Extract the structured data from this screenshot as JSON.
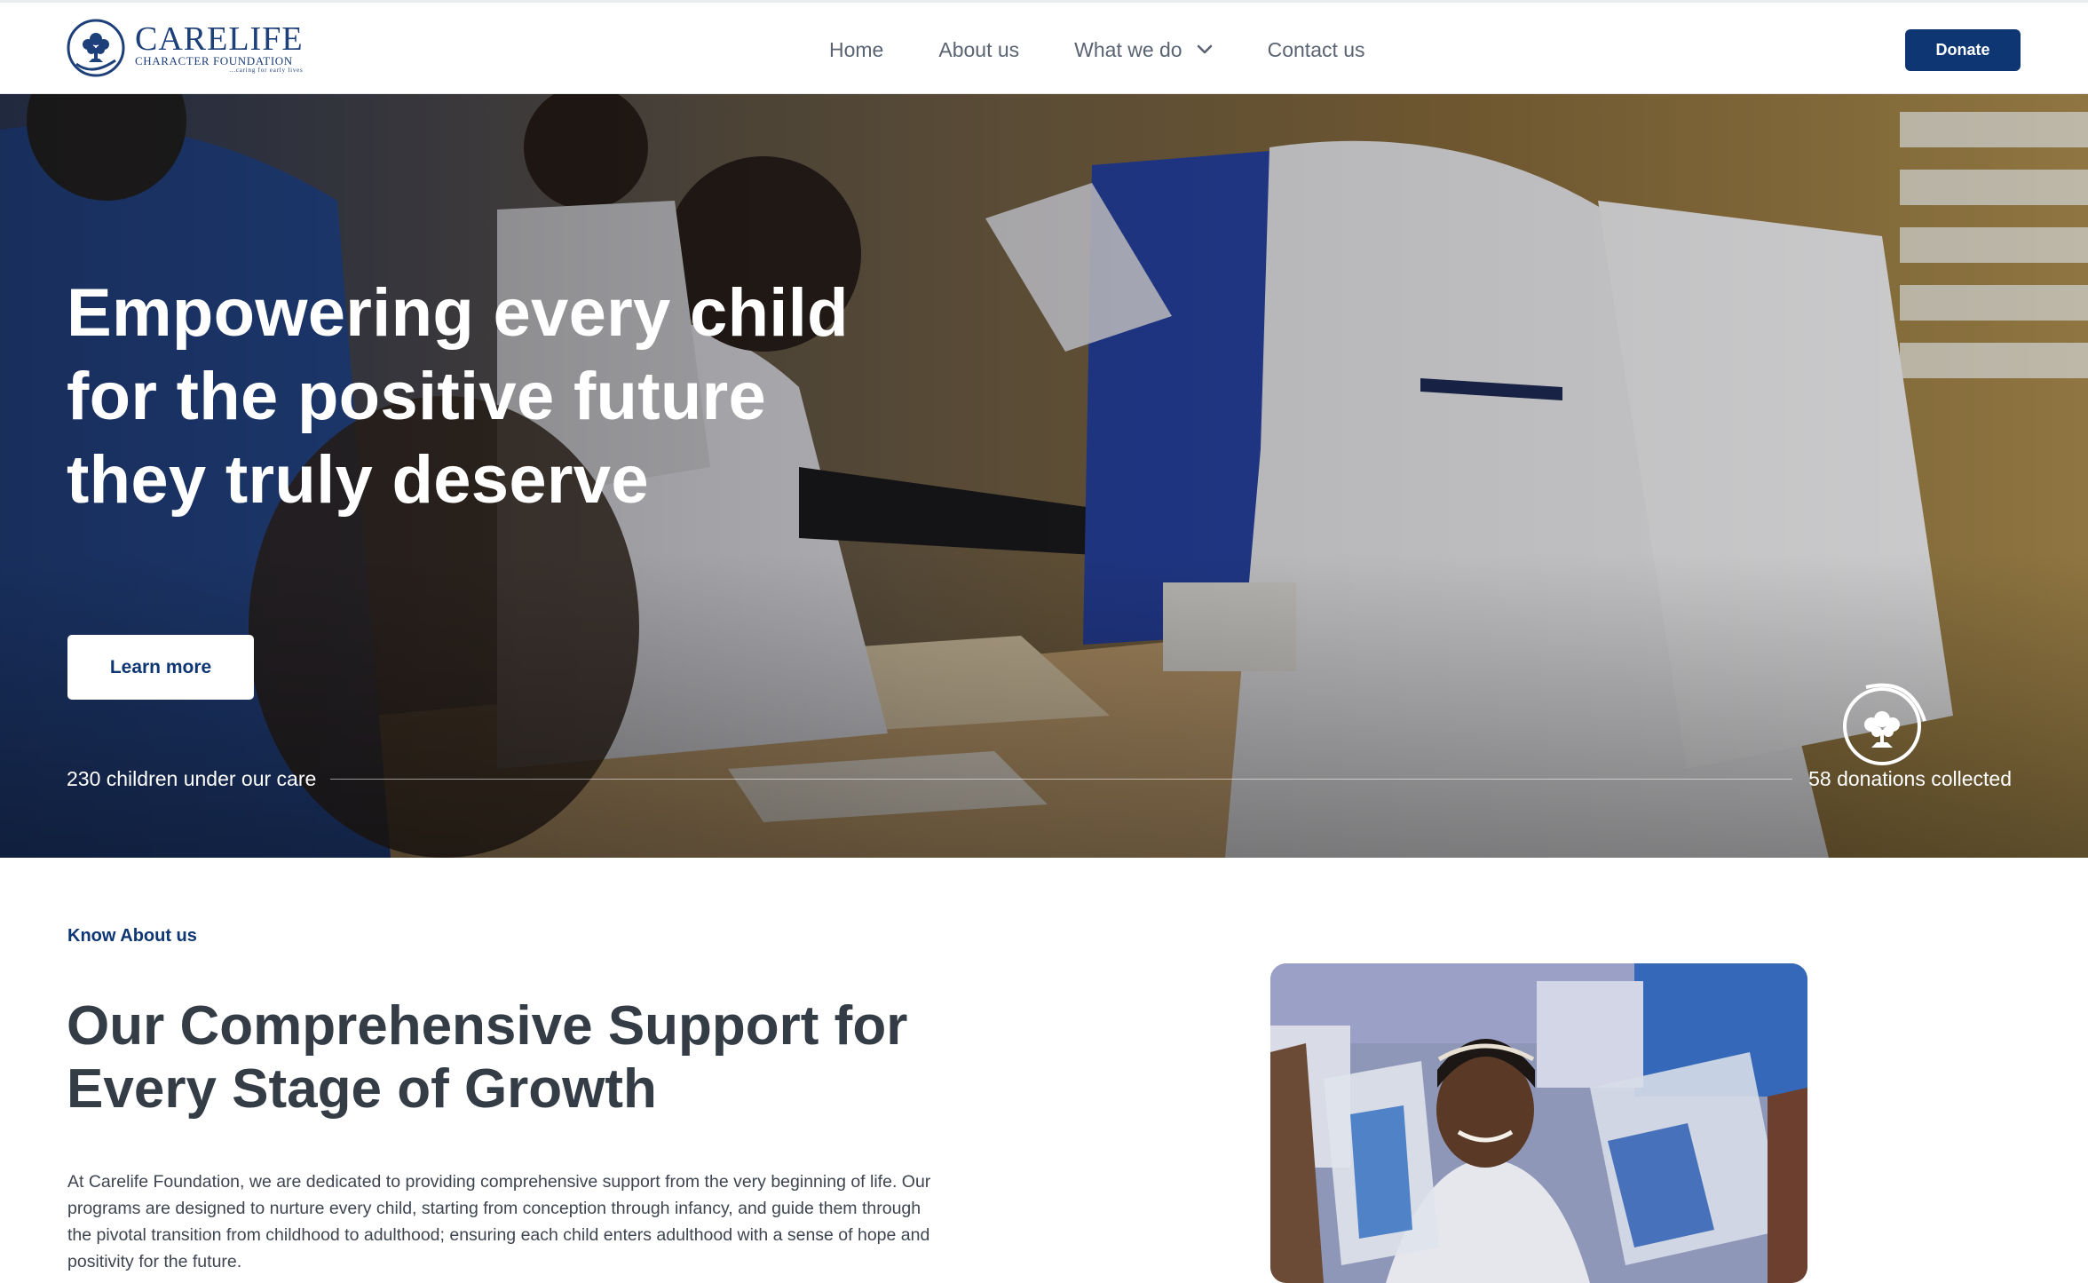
{
  "header": {
    "logo": {
      "title": "CARELIFE",
      "subtitle": "CHARACTER FOUNDATION",
      "tagline": "...caring for early lives"
    },
    "nav": [
      {
        "label": "Home"
      },
      {
        "label": "About us"
      },
      {
        "label": "What we do",
        "has_dropdown": true
      },
      {
        "label": "Contact us"
      }
    ],
    "donate_label": "Donate"
  },
  "hero": {
    "headline": "Empowering every child for the positive future they truly deserve",
    "cta_label": "Learn more",
    "stat_left": "230 children under our care",
    "stat_right": "58 donations collected"
  },
  "about": {
    "eyebrow": "Know About us",
    "title": "Our Comprehensive Support for Every Stage of Growth",
    "body": "At Carelife Foundation, we are dedicated to providing comprehensive support from the very beginning of life. Our programs are designed to nurture every child, starting from conception through infancy, and guide them through the pivotal transition from childhood to adulthood; ensuring each child enters adulthood with a sense of hope and positivity for the future."
  },
  "colors": {
    "brand": "#0d3673",
    "text_dark": "#343c46",
    "nav_text": "#5a6472"
  },
  "icons": [
    "logo-tree-icon",
    "chevron-down-icon",
    "emblem-tree-icon"
  ]
}
